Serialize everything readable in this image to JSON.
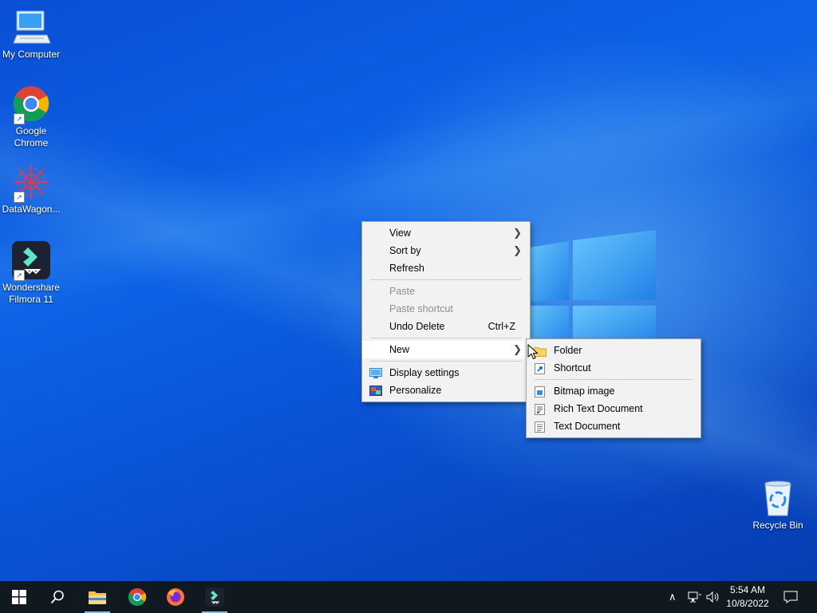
{
  "desktop": {
    "icons": [
      {
        "label": "My Computer",
        "icon": "computer-icon"
      },
      {
        "label": "Google Chrome",
        "icon": "chrome-icon"
      },
      {
        "label": "DataWagon...",
        "icon": "datawagon-icon"
      },
      {
        "label": "Wondershare Filmora 11",
        "icon": "filmora-icon"
      },
      {
        "label": "Recycle Bin",
        "icon": "recycle-bin-icon"
      }
    ]
  },
  "context_menu": {
    "items": [
      {
        "label": "View",
        "submenu": true
      },
      {
        "label": "Sort by",
        "submenu": true
      },
      {
        "label": "Refresh"
      },
      {
        "label": "Paste",
        "disabled": true
      },
      {
        "label": "Paste shortcut",
        "disabled": true
      },
      {
        "label": "Undo Delete",
        "shortcut": "Ctrl+Z"
      },
      {
        "label": "New",
        "submenu": true,
        "highlighted": true
      },
      {
        "label": "Display settings",
        "icon": "display-settings-icon"
      },
      {
        "label": "Personalize",
        "icon": "personalize-icon"
      }
    ]
  },
  "new_submenu": {
    "items": [
      {
        "label": "Folder",
        "icon": "folder-icon"
      },
      {
        "label": "Shortcut",
        "icon": "shortcut-icon"
      },
      {
        "label": "Bitmap image",
        "icon": "bitmap-icon"
      },
      {
        "label": "Rich Text Document",
        "icon": "rich-text-icon"
      },
      {
        "label": "Text Document",
        "icon": "text-document-icon"
      }
    ]
  },
  "taskbar": {
    "apps": [
      {
        "name": "start",
        "icon": "windows-start-icon"
      },
      {
        "name": "search",
        "icon": "search-icon"
      },
      {
        "name": "file-explorer",
        "icon": "folder-icon",
        "active": true
      },
      {
        "name": "chrome",
        "icon": "chrome-icon"
      },
      {
        "name": "firefox",
        "icon": "firefox-icon"
      },
      {
        "name": "filmora",
        "icon": "filmora-icon",
        "active": true
      }
    ],
    "clock": {
      "time": "5:54 AM",
      "date": "10/8/2022"
    }
  },
  "colors": {
    "accent": "#0a5ad8",
    "taskbar": "#101820",
    "menu_bg": "#f2f2f2"
  }
}
